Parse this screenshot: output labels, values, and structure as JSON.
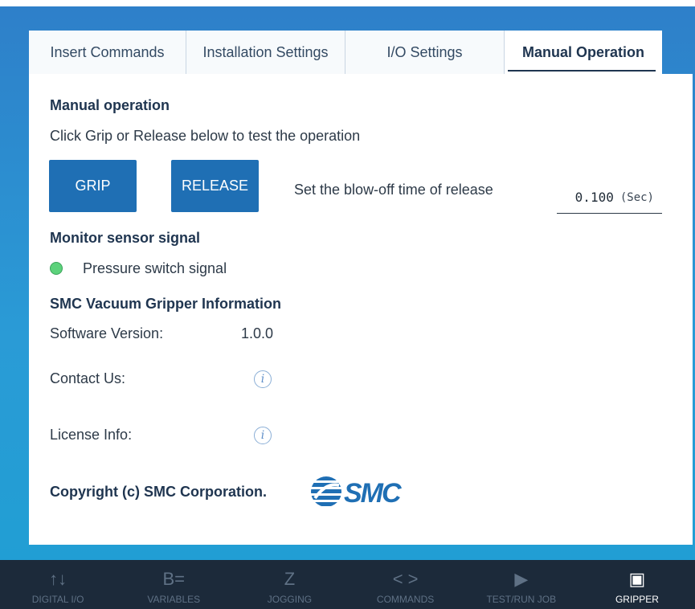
{
  "tabs": [
    {
      "label": "Insert Commands"
    },
    {
      "label": "Installation Settings"
    },
    {
      "label": "I/O Settings"
    },
    {
      "label": "Manual Operation"
    }
  ],
  "manual_operation": {
    "heading": "Manual operation",
    "instruction": "Click Grip or Release below to test the operation",
    "grip_label": "GRIP",
    "release_label": "RELEASE",
    "blowoff_label": "Set the blow-off time of release",
    "blowoff_value": "0.100",
    "blowoff_unit": "(Sec)"
  },
  "monitor": {
    "heading": "Monitor sensor signal",
    "pressure_label": "Pressure switch signal",
    "pressure_status_color": "#5cd27b"
  },
  "info": {
    "heading": "SMC Vacuum Gripper Information",
    "software_version_label": "Software Version:",
    "software_version_value": "1.0.0",
    "contact_label": "Contact Us:",
    "license_label": "License Info:",
    "info_icon_glyph": "i",
    "copyright": "Copyright (c) SMC Corporation.",
    "logo_text": "SMC"
  },
  "bottom_nav": [
    {
      "label": "DIGITAL I/O",
      "icon": "↑↓"
    },
    {
      "label": "VARIABLES",
      "icon": "B="
    },
    {
      "label": "JOGGING",
      "icon": "Z"
    },
    {
      "label": "COMMANDS",
      "icon": "< >"
    },
    {
      "label": "TEST/RUN JOB",
      "icon": "▶"
    },
    {
      "label": "GRIPPER",
      "icon": "▣",
      "active": true
    }
  ],
  "colors": {
    "accent": "#1f6fb4",
    "nav_bg": "#1c2a3a",
    "frame": "#2a9bd6"
  }
}
